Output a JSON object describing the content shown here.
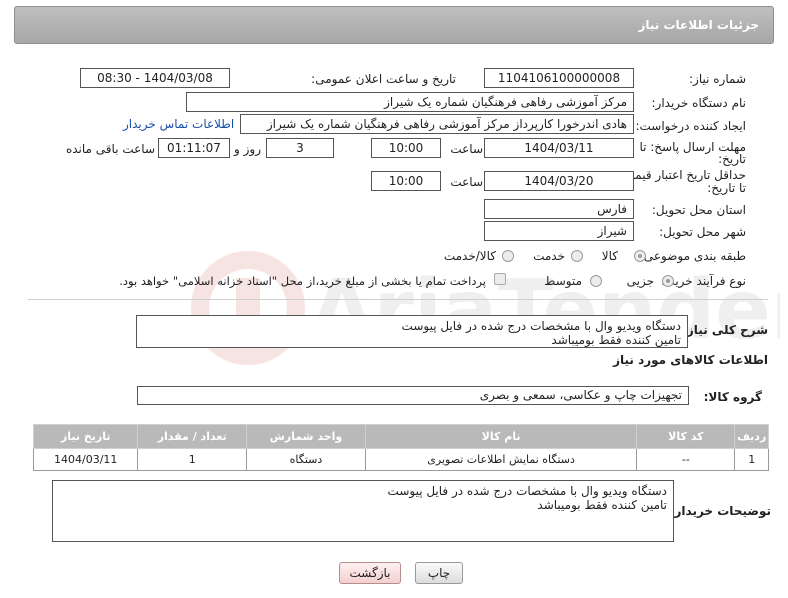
{
  "header": {
    "title": "جزئیات اطلاعات نیاز"
  },
  "fields": {
    "need_number_label": "شماره نیاز:",
    "need_number": "1104106100000008",
    "announce_label": "تاریخ و ساعت اعلان عمومی:",
    "announce_value": "1404/03/08 - 08:30",
    "buyer_label": "نام دستگاه خریدار:",
    "buyer_value": "مرکز آموزشی رفاهی فرهنگیان شماره یک شیراز",
    "creator_label": "ایجاد کننده درخواست:",
    "creator_value": "هادی اندرخورا کارپرداز مرکز آموزشی رفاهی فرهنگیان شماره یک شیراز",
    "contact_link": "اطلاعات تماس خریدار",
    "deadline_label_1": "مهلت ارسال پاسخ: تا",
    "deadline_label_2": "تاریخ:",
    "deadline_date": "1404/03/11",
    "time_label": "ساعت",
    "deadline_time": "10:00",
    "days_value": "3",
    "days_label": "روز و",
    "remaining_time": "01:11:07",
    "remaining_label": "ساعت باقی مانده",
    "validity_label_1": "حداقل تاریخ اعتبار قیمت:",
    "validity_label_2": "تا تاریخ:",
    "validity_date": "1404/03/20",
    "validity_time": "10:00",
    "province_label": "استان محل تحویل:",
    "province_value": "فارس",
    "city_label": "شهر محل تحویل:",
    "city_value": "شیراز",
    "category_label": "طبقه بندی موضوعی:",
    "category_options": [
      "کالا",
      "خدمت",
      "کالا/خدمت"
    ],
    "process_label": "نوع فرآیند خرید :",
    "process_options": [
      "جزیی",
      "متوسط"
    ],
    "payment_note": "پرداخت تمام یا بخشی از مبلغ خرید،از محل \"اسناد خزانه اسلامی\" خواهد بود."
  },
  "description": {
    "label": "شرح کلی نیاز:",
    "text": "دستگاه ویدیو وال با مشخصات درج شده در فایل پیوست\nتامین کننده فقط بومیباشد"
  },
  "goods": {
    "section_title": "اطلاعات کالاهای مورد نیاز",
    "group_label": "گروه کالا:",
    "group_value": "تجهیزات چاپ و عکاسی، سمعی و بصری",
    "table": {
      "headers": [
        "ردیف",
        "کد کالا",
        "نام کالا",
        "واحد شمارش",
        "تعداد / مقدار",
        "تاریخ نیاز"
      ],
      "rows": [
        [
          "1",
          "--",
          "دستگاه نمایش اطلاعات تصویری",
          "دستگاه",
          "1",
          "1404/03/11"
        ]
      ]
    }
  },
  "buyer_notes": {
    "label": "توضیحات خریدار:",
    "text": "دستگاه ویدیو وال با مشخصات درج شده در فایل پیوست\nتامین کننده فقط بومیباشد"
  },
  "buttons": {
    "print": "چاپ",
    "back": "بازگشت"
  },
  "colors": {
    "header_bg": "#b3b3b3",
    "link": "#1a4fa8",
    "back_button": "#f3cfcf"
  }
}
